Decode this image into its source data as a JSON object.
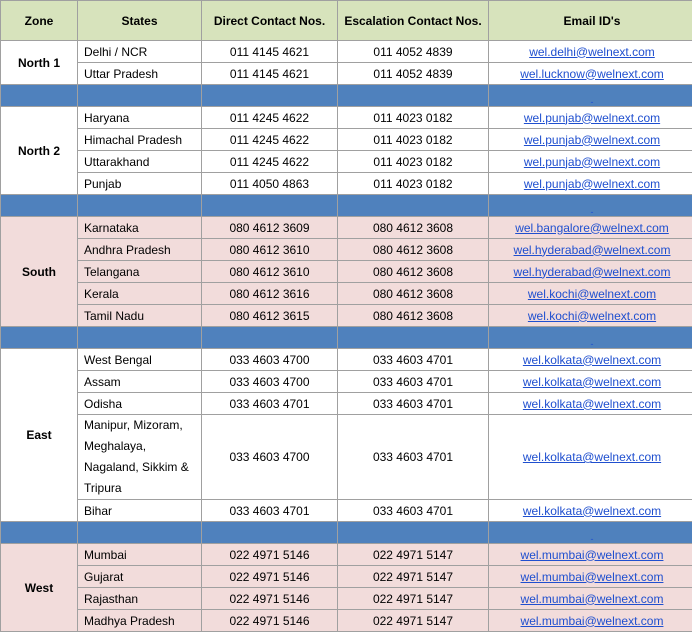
{
  "headers": {
    "zone": "Zone",
    "states": "States",
    "direct": "Direct Contact Nos.",
    "escalation": "Escalation Contact Nos.",
    "email": "Email ID's"
  },
  "separator_link": "-",
  "zones": [
    {
      "name": "North 1",
      "rows": [
        {
          "state": "Delhi / NCR",
          "direct": "011 4145 4621",
          "escalation": "011 4052 4839",
          "email": "wel.delhi@welnext.com"
        },
        {
          "state": "Uttar Pradesh",
          "direct": "011 4145 4621",
          "escalation": "011 4052 4839",
          "email": "wel.lucknow@welnext.com"
        }
      ]
    },
    {
      "name": "North 2",
      "rows": [
        {
          "state": "Haryana",
          "direct": "011 4245 4622",
          "escalation": "011 4023 0182",
          "email": "wel.punjab@welnext.com"
        },
        {
          "state": "Himachal Pradesh",
          "direct": "011 4245 4622",
          "escalation": "011 4023 0182",
          "email": "wel.punjab@welnext.com"
        },
        {
          "state": "Uttarakhand",
          "direct": "011 4245 4622",
          "escalation": "011 4023 0182",
          "email": "wel.punjab@welnext.com"
        },
        {
          "state": "Punjab",
          "direct": "011 4050 4863",
          "escalation": "011 4023 0182",
          "email": "wel.punjab@welnext.com"
        }
      ]
    },
    {
      "name": "South",
      "rows": [
        {
          "state": "Karnataka",
          "direct": "080 4612 3609",
          "escalation": "080 4612 3608",
          "email": "wel.bangalore@welnext.com"
        },
        {
          "state": "Andhra Pradesh",
          "direct": "080 4612 3610",
          "escalation": "080 4612 3608",
          "email": "wel.hyderabad@welnext.com"
        },
        {
          "state": "Telangana",
          "direct": "080 4612 3610",
          "escalation": "080 4612 3608",
          "email": "wel.hyderabad@welnext.com"
        },
        {
          "state": "Kerala",
          "direct": "080 4612 3616",
          "escalation": "080 4612 3608",
          "email": "wel.kochi@welnext.com"
        },
        {
          "state": "Tamil Nadu",
          "direct": "080 4612 3615",
          "escalation": "080 4612 3608",
          "email": "wel.kochi@welnext.com"
        }
      ]
    },
    {
      "name": "East",
      "rows": [
        {
          "state": "West Bengal",
          "direct": "033 4603 4700",
          "escalation": "033 4603 4701",
          "email": "wel.kolkata@welnext.com"
        },
        {
          "state": "Assam",
          "direct": "033 4603 4700",
          "escalation": "033 4603 4701",
          "email": "wel.kolkata@welnext.com"
        },
        {
          "state": "Odisha",
          "direct": "033 4603 4701",
          "escalation": "033 4603 4701",
          "email": "wel.kolkata@welnext.com"
        },
        {
          "state": "Manipur, Mizoram, Meghalaya, Nagaland, Sikkim & Tripura",
          "direct": "033 4603 4700",
          "escalation": "033 4603 4701",
          "email": "wel.kolkata@welnext.com"
        },
        {
          "state": "Bihar",
          "direct": "033 4603 4701",
          "escalation": "033 4603 4701",
          "email": "wel.kolkata@welnext.com"
        }
      ]
    },
    {
      "name": "West",
      "rows": [
        {
          "state": "Mumbai",
          "direct": "022 4971 5146",
          "escalation": "022 4971 5147",
          "email": "wel.mumbai@welnext.com"
        },
        {
          "state": "Gujarat",
          "direct": "022 4971 5146",
          "escalation": "022 4971 5147",
          "email": "wel.mumbai@welnext.com"
        },
        {
          "state": "Rajasthan",
          "direct": "022 4971 5146",
          "escalation": "022 4971 5147",
          "email": "wel.mumbai@welnext.com"
        },
        {
          "state": "Madhya Pradesh",
          "direct": "022 4971 5146",
          "escalation": "022 4971 5147",
          "email": "wel.mumbai@welnext.com"
        }
      ]
    }
  ]
}
